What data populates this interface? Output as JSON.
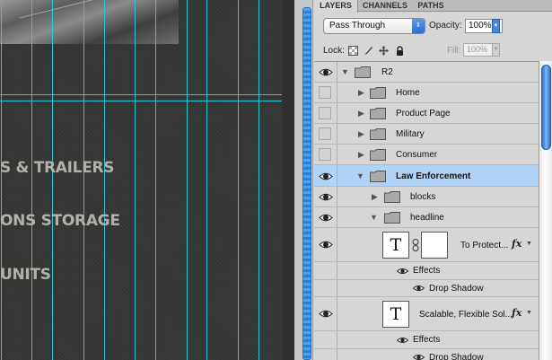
{
  "canvas": {
    "texts": [
      "S & TRAILERS",
      "ONS STORAGE",
      "UNITS"
    ]
  },
  "panel": {
    "tabs": [
      {
        "label": "LAYERS",
        "active": true
      },
      {
        "label": "CHANNELS",
        "active": false
      },
      {
        "label": "PATHS",
        "active": false
      }
    ],
    "blend_mode": "Pass Through",
    "opacity_label": "Opacity:",
    "opacity_value": "100%",
    "lock_label": "Lock:",
    "fill_label": "Fill:",
    "fill_value": "100%"
  },
  "layers": [
    {
      "name": "R2",
      "visible": true,
      "expanded": true,
      "type": "group"
    },
    {
      "name": "Home",
      "visible": false,
      "expanded": false,
      "type": "group"
    },
    {
      "name": "Product Page",
      "visible": false,
      "expanded": false,
      "type": "group"
    },
    {
      "name": "Military",
      "visible": false,
      "expanded": false,
      "type": "group"
    },
    {
      "name": "Consumer",
      "visible": false,
      "expanded": false,
      "type": "group"
    },
    {
      "name": "Law Enforcement",
      "visible": true,
      "expanded": true,
      "type": "group",
      "selected": true
    },
    {
      "name": "blocks",
      "visible": true,
      "expanded": false,
      "type": "group"
    },
    {
      "name": "headline",
      "visible": true,
      "expanded": true,
      "type": "group"
    },
    {
      "name": "To Protect...",
      "visible": true,
      "type": "text",
      "has_mask": true,
      "has_fx": true
    },
    {
      "name": "Effects",
      "visible": true,
      "type": "effects"
    },
    {
      "name": "Drop Shadow",
      "visible": true,
      "type": "effect"
    },
    {
      "name": "Scalable, Flexible Sol...",
      "visible": true,
      "type": "text",
      "has_mask": false,
      "has_fx": true
    },
    {
      "name": "Effects",
      "visible": true,
      "type": "effects"
    },
    {
      "name": "Drop Shadow",
      "visible": true,
      "type": "effect"
    }
  ],
  "colors": {
    "guide": "#25c9d6",
    "selected_row": "#b1d3f7",
    "accent_blue": "#2a6fd0"
  }
}
